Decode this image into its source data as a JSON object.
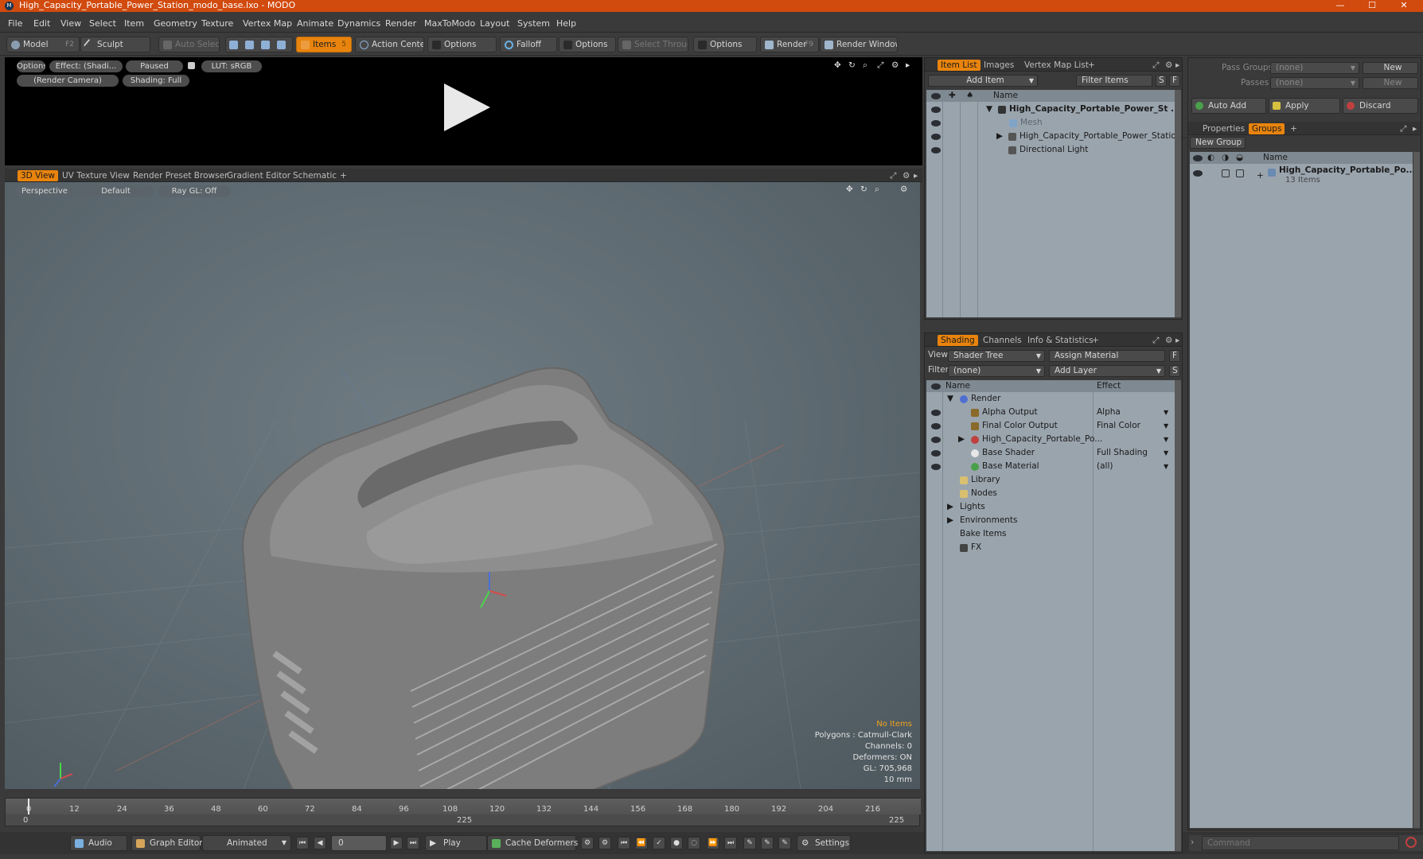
{
  "window": {
    "title": "High_Capacity_Portable_Power_Station_modo_base.lxo - MODO",
    "app_icon": "modo-icon"
  },
  "menu": [
    "File",
    "Edit",
    "View",
    "Select",
    "Item",
    "Geometry",
    "Texture",
    "Vertex Map",
    "Animate",
    "Dynamics",
    "Render",
    "MaxToModo",
    "Layout",
    "System",
    "Help"
  ],
  "toolbar": {
    "model": "Model",
    "model_key": "F2",
    "sculpt": "Sculpt",
    "auto_select": "Auto Select",
    "items": "Items",
    "items_key": "5",
    "action_center": "Action Center",
    "options1": "Options",
    "falloff": "Falloff",
    "options2": "Options",
    "select_through": "Select Through",
    "options3": "Options",
    "render": "Render",
    "render_key": "F9",
    "render_window": "Render Window"
  },
  "render_preview": {
    "options": "Options",
    "effect": "Effect: (Shadi...",
    "paused": "Paused",
    "lut": "LUT: sRGB",
    "camera": "(Render Camera)",
    "shading": "Shading: Full"
  },
  "viewport_tabs": [
    "3D View",
    "UV Texture View",
    "Render Preset Browser",
    "Gradient Editor",
    "Schematic"
  ],
  "viewport": {
    "perspective": "Perspective",
    "default": "Default",
    "raygl": "Ray GL: Off",
    "info": {
      "items": "No Items",
      "polygons": "Polygons : Catmull-Clark",
      "channels": "Channels: 0",
      "deformers": "Deformers: ON",
      "gl": "GL: 705,968",
      "scale": "10 mm"
    }
  },
  "timeline": {
    "ticks": [
      "0",
      "12",
      "24",
      "36",
      "48",
      "60",
      "72",
      "84",
      "96",
      "108",
      "120",
      "132",
      "144",
      "156",
      "168",
      "180",
      "192",
      "204",
      "216"
    ],
    "start": "0",
    "mid": "225",
    "end": "225"
  },
  "bottom": {
    "audio": "Audio",
    "graph_editor": "Graph Editor",
    "animated": "Animated",
    "frame": "0",
    "play": "Play",
    "cache_deformers": "Cache Deformers",
    "settings": "Settings",
    "command_placeholder": "Command"
  },
  "item_list": {
    "tabs": [
      "Item List",
      "Images",
      "Vertex Map List"
    ],
    "add_item": "Add Item",
    "filter": "Filter Items",
    "s": "S",
    "f": "F",
    "col_name": "Name",
    "rows": [
      {
        "label": "High_Capacity_Portable_Power_St ...",
        "bold": true
      },
      {
        "label": "Mesh",
        "dim": true
      },
      {
        "label": "High_Capacity_Portable_Power_Statio ..."
      },
      {
        "label": "Directional Light"
      }
    ]
  },
  "shading": {
    "tabs": [
      "Shading",
      "Channels",
      "Info & Statistics"
    ],
    "view_label": "View",
    "view_value": "Shader Tree",
    "assign_material": "Assign Material",
    "f": "F",
    "filter_label": "Filter",
    "filter_value": "(none)",
    "add_layer": "Add Layer",
    "s": "S",
    "col_name": "Name",
    "col_effect": "Effect",
    "rows": [
      {
        "label": "Render",
        "effect": ""
      },
      {
        "label": "Alpha Output",
        "effect": "Alpha"
      },
      {
        "label": "Final Color Output",
        "effect": "Final Color"
      },
      {
        "label": "High_Capacity_Portable_Po...",
        "effect": ""
      },
      {
        "label": "Base Shader",
        "effect": "Full Shading"
      },
      {
        "label": "Base Material",
        "effect": "(all)"
      },
      {
        "label": "Library",
        "effect": ""
      },
      {
        "label": "Nodes",
        "effect": ""
      },
      {
        "label": "Lights",
        "effect": ""
      },
      {
        "label": "Environments",
        "effect": ""
      },
      {
        "label": "Bake Items",
        "effect": ""
      },
      {
        "label": "FX",
        "effect": ""
      }
    ]
  },
  "groups_panel": {
    "pass_groups": "Pass Groups",
    "pass_groups_value": "(none)",
    "new": "New",
    "passes": "Passes",
    "passes_value": "(none)",
    "new2": "New",
    "auto_add": "Auto Add",
    "apply": "Apply",
    "discard": "Discard",
    "tabs": [
      "Properties",
      "Groups"
    ],
    "new_group": "New Group",
    "col_name": "Name",
    "group_name": "High_Capacity_Portable_Po...",
    "group_count": "13 Items"
  },
  "colors": {
    "accent": "#e8840e",
    "title_bar": "#d14a0e",
    "list_bg": "#9aa4ad"
  }
}
